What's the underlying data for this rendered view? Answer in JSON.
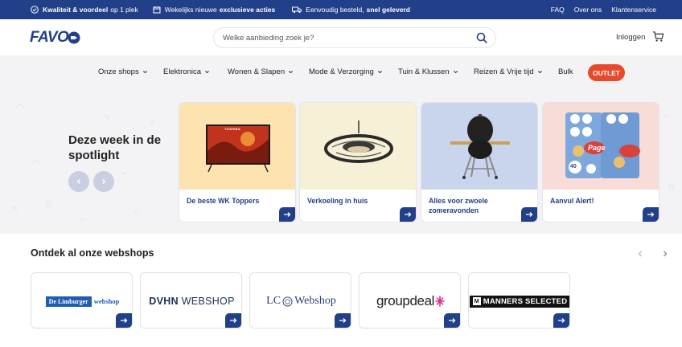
{
  "topbar": {
    "usps": [
      {
        "bold": "Kwaliteit & voordeel",
        "text": "op 1 plek",
        "icon": "check-circle-icon"
      },
      {
        "bold": "",
        "text": "Wekelijks nieuwe",
        "bold2": "exclusieve acties",
        "icon": "calendar-icon"
      },
      {
        "bold": "",
        "text": "Eenvoudig besteld,",
        "bold2": "snel geleverd",
        "icon": "truck-icon"
      }
    ],
    "links": [
      "FAQ",
      "Over ons",
      "Klantenservice"
    ]
  },
  "header": {
    "logo_text": "FAVO",
    "search_placeholder": "Welke aanbieding zoek je?",
    "login_label": "Inloggen",
    "cart_icon": "cart-icon"
  },
  "nav": {
    "items": [
      "Onze shops",
      "Elektronica",
      "Wonen & Slapen",
      "Mode & Verzorging",
      "Tuin & Klussen",
      "Reizen & Vrije tijd",
      "Bulk"
    ],
    "outlet_label": "OUTLET",
    "outlet_color": "#e8482b"
  },
  "spotlight": {
    "title": "Deze week in de spotlight",
    "cards": [
      {
        "label": "De beste WK Toppers",
        "bg": "#fde3b0"
      },
      {
        "label": "Verkoeling in huis",
        "bg": "#f6f0d6"
      },
      {
        "label": "Alles voor zwoele zomeravonden",
        "bg": "#c9d5ec"
      },
      {
        "label": "Aanvul Alert!",
        "bg": "#f7dcd7"
      }
    ],
    "tv_brand": "TOSHIBA",
    "page_brand": "Page",
    "page_count": "40"
  },
  "webshops": {
    "title": "Ontdek al onze webshops",
    "shops": [
      {
        "name": "De Limburger webshop",
        "part1": "De Limburger",
        "part2": "webshop"
      },
      {
        "name": "DVHN WEBSHOP",
        "part1": "DVHN",
        "part2": "WEBSHOP"
      },
      {
        "name": "LC Webshop",
        "part1": "LC",
        "part2": "Webshop"
      },
      {
        "name": "groupdeal",
        "part1": "groupdeal"
      },
      {
        "name": "MANNERS SELECTED",
        "part1": "M",
        "part2": "MANNERS SELECTED"
      }
    ]
  },
  "colors": {
    "brand": "#22408a",
    "background_grey": "#f3f3f5"
  }
}
